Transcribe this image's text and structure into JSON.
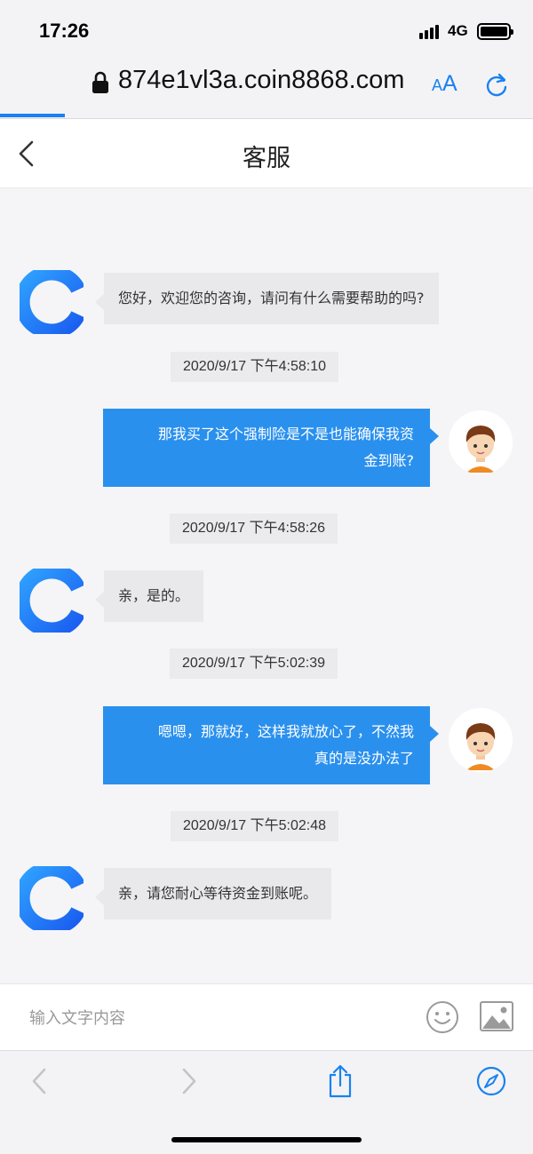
{
  "status_bar": {
    "time": "17:26",
    "network": "4G"
  },
  "browser": {
    "url": "874e1vl3a.coin8868.com",
    "text_size_small": "A",
    "text_size_large": "A",
    "icons": [
      "lock-icon",
      "text-size-icon",
      "reload-icon"
    ],
    "accent": "#1a82f0"
  },
  "header": {
    "title": "客服"
  },
  "chat": {
    "messages": [
      {
        "from": "agent",
        "lines": [
          "您好，欢迎您的咨询，请问有什么需要帮助的吗?"
        ]
      },
      {
        "timestamp": "2020/9/17 下午4:58:10"
      },
      {
        "from": "user",
        "lines": [
          "那我买了这个强制险是不是也能确保我资",
          "金到账?"
        ]
      },
      {
        "timestamp": "2020/9/17 下午4:58:26"
      },
      {
        "from": "agent",
        "lines": [
          "亲，是的。"
        ]
      },
      {
        "timestamp": "2020/9/17 下午5:02:39"
      },
      {
        "from": "user",
        "lines": [
          "嗯嗯，那就好，这样我就放心了，不然我",
          "真的是没办法了"
        ]
      },
      {
        "timestamp": "2020/9/17 下午5:02:48"
      },
      {
        "from": "agent",
        "lines": [
          "亲，请您耐心等待资金到账呢。"
        ]
      }
    ],
    "user_bubble_color": "#2a90ee",
    "agent_bubble_color": "#e9e9ec"
  },
  "input": {
    "placeholder": "输入文字内容",
    "icons": [
      "emoji-icon",
      "image-icon"
    ]
  },
  "toolbar": {
    "icons": [
      "back-icon",
      "forward-icon",
      "share-icon",
      "compass-icon"
    ]
  }
}
